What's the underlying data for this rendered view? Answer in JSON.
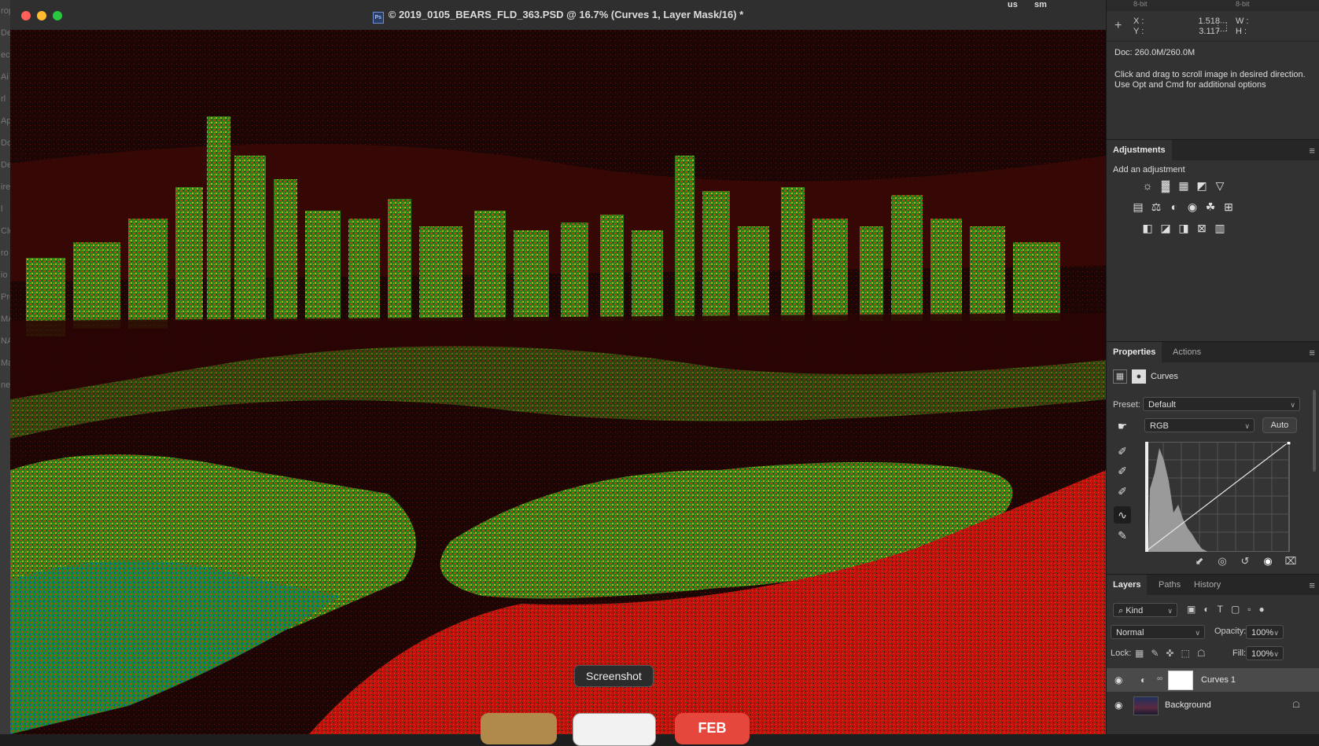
{
  "app": {
    "accent": "#3c7be0"
  },
  "left_strip": {
    "fragments": [
      "ropbox",
      "De",
      "ec",
      "Ai",
      "rl",
      "Ap",
      "Do",
      "De",
      "ire",
      "l",
      "Clo",
      "ro",
      "io",
      "Pro",
      "MAI",
      "NA",
      "Mai",
      "net"
    ]
  },
  "document": {
    "title": "© 2019_0105_BEARS_FLD_363.PSD @ 16.7% (Curves 1, Layer Mask/16) *",
    "file_icon": "photoshop-file-icon",
    "image_description": "psychedelic false-color aerial view of a city skyline"
  },
  "dock": {
    "tooltip": "Screenshot",
    "calendar_month": "FEB"
  },
  "info_panel": {
    "top_labels": [
      "8-bit",
      "8-bit"
    ],
    "x_label": "X :",
    "y_label": "Y :",
    "x_value": "1.518",
    "y_value": "3.117",
    "w_label": "W :",
    "h_label": "H :",
    "doc_size": "Doc: 260.0M/260.0M",
    "hint": "Click and drag to scroll image in desired direction.\nUse Opt and Cmd for additional options"
  },
  "adjustments_panel": {
    "tab": "Adjustments",
    "add_label": "Add an adjustment",
    "icons_row1": [
      "☼",
      "▓",
      "▦",
      "◩",
      "▽"
    ],
    "icons_row2": [
      "▤",
      "⚖",
      "◐",
      "◉",
      "☘",
      "⊞"
    ],
    "icons_row3": [
      "◧",
      "◪",
      "◨",
      "⊠",
      "▥"
    ]
  },
  "properties_panel": {
    "tabs": [
      "Properties",
      "Actions"
    ],
    "type": "Curves",
    "preset_label": "Preset:",
    "preset_value": "Default",
    "channel": "RGB",
    "auto_button": "Auto",
    "footer_icons": [
      "clip-to-layer-icon",
      "view-previous-icon",
      "reset-icon",
      "visibility-icon",
      "trash-icon"
    ]
  },
  "layers_panel": {
    "tabs": [
      "Layers",
      "Paths",
      "History"
    ],
    "filter_kind": "Kind",
    "blend_mode": "Normal",
    "opacity_label": "Opacity:",
    "opacity_value": "100%",
    "lock_label": "Lock:",
    "fill_label": "Fill:",
    "fill_value": "100%",
    "layers": [
      {
        "name": "Curves 1",
        "selected": true
      },
      {
        "name": "Background",
        "selected": false
      }
    ]
  },
  "partial_top": {
    "left_text": "us",
    "right_text": "sm"
  }
}
